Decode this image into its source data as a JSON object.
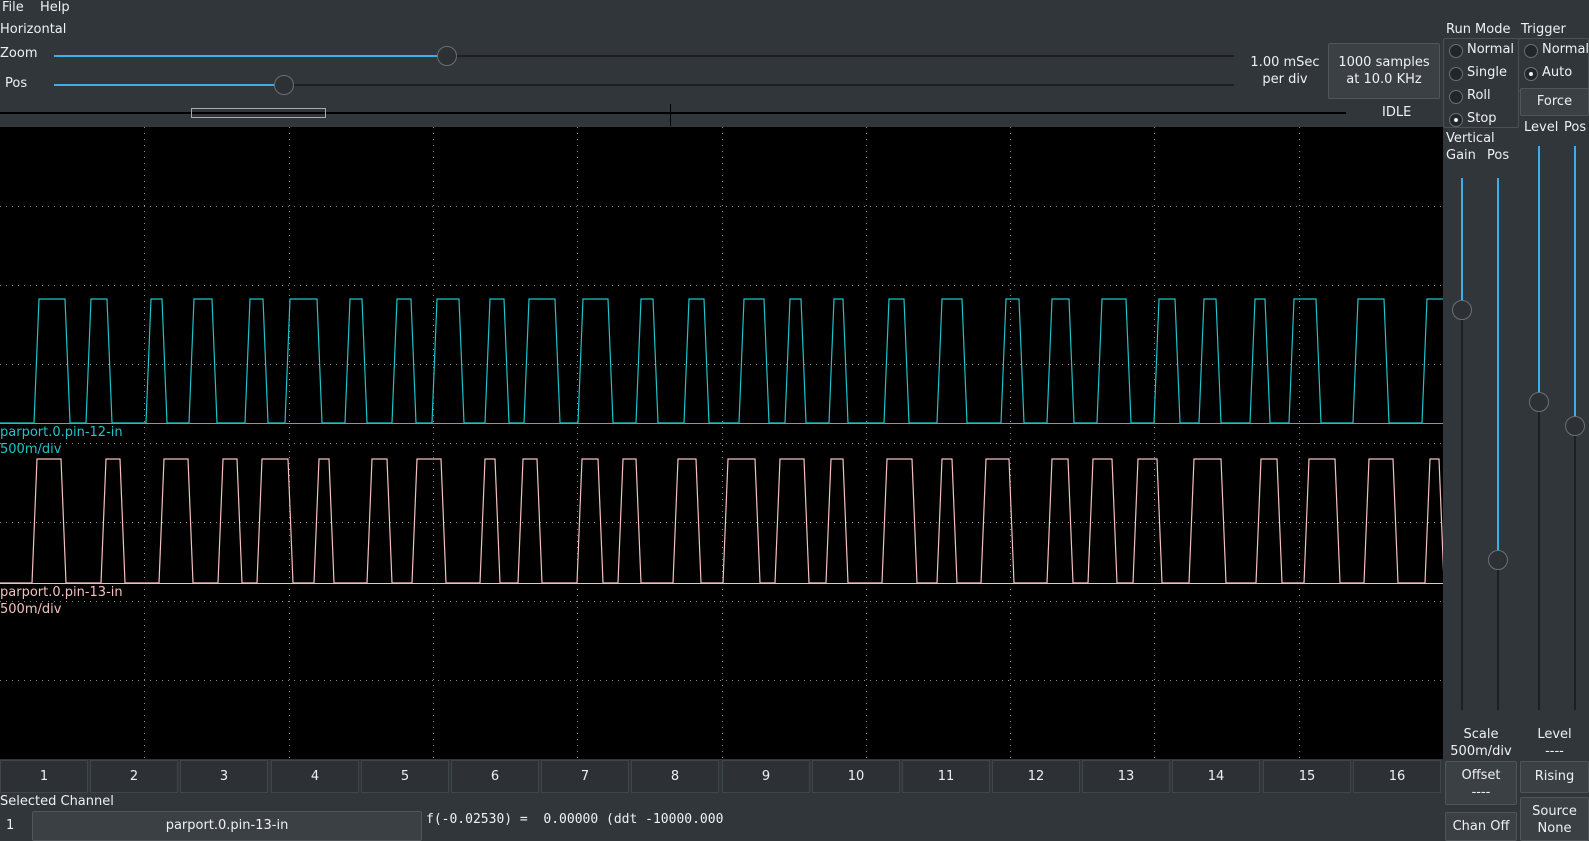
{
  "menu": [
    "File",
    "Help"
  ],
  "horizontal": {
    "title": "Horizontal",
    "zoom_label": "Zoom",
    "pos_label": "Pos",
    "zoom_value": 0.33,
    "pos_value": 0.19,
    "time_per_div": "1.00 mSec\nper div",
    "samples": "1000 samples\nat 10.0 KHz",
    "status": "IDLE"
  },
  "run_mode": {
    "title": "Run Mode",
    "options": [
      "Normal",
      "Single",
      "Roll",
      "Stop"
    ],
    "selected": "Stop"
  },
  "trigger": {
    "title": "Trigger",
    "options": [
      "Normal",
      "Auto"
    ],
    "selected": "Auto",
    "force_label": "Force",
    "level_label": "Level",
    "pos_label": "Pos",
    "level_value_label": "Level\n----",
    "edge_label": "Rising",
    "source_label": "Source\nNone"
  },
  "vertical": {
    "title": "Vertical",
    "gain_label": "Gain",
    "pos_label": "Pos",
    "scale_label": "Scale\n500m/div",
    "offset_label": "Offset\n----",
    "chan_off_label": "Chan Off"
  },
  "traces": [
    {
      "name": "parport.0.pin-12-in",
      "scale": "500m/div",
      "color": "#1fc3c9"
    },
    {
      "name": "parport.0.pin-13-in",
      "scale": "500m/div",
      "color": "#f3c1bd"
    }
  ],
  "channel_buttons": [
    "1",
    "2",
    "3",
    "4",
    "5",
    "6",
    "7",
    "8",
    "9",
    "10",
    "11",
    "12",
    "13",
    "14",
    "15",
    "16"
  ],
  "selected_channel": {
    "title": "Selected Channel",
    "number": "1",
    "name": "parport.0.pin-13-in",
    "readout": "f(-0.02530) =  0.00000 (ddt -10000.000"
  },
  "colors": {
    "background": "#31363b",
    "accent": "#3daee9",
    "scope_bg": "#000000",
    "grid": "#8a8a8a"
  }
}
